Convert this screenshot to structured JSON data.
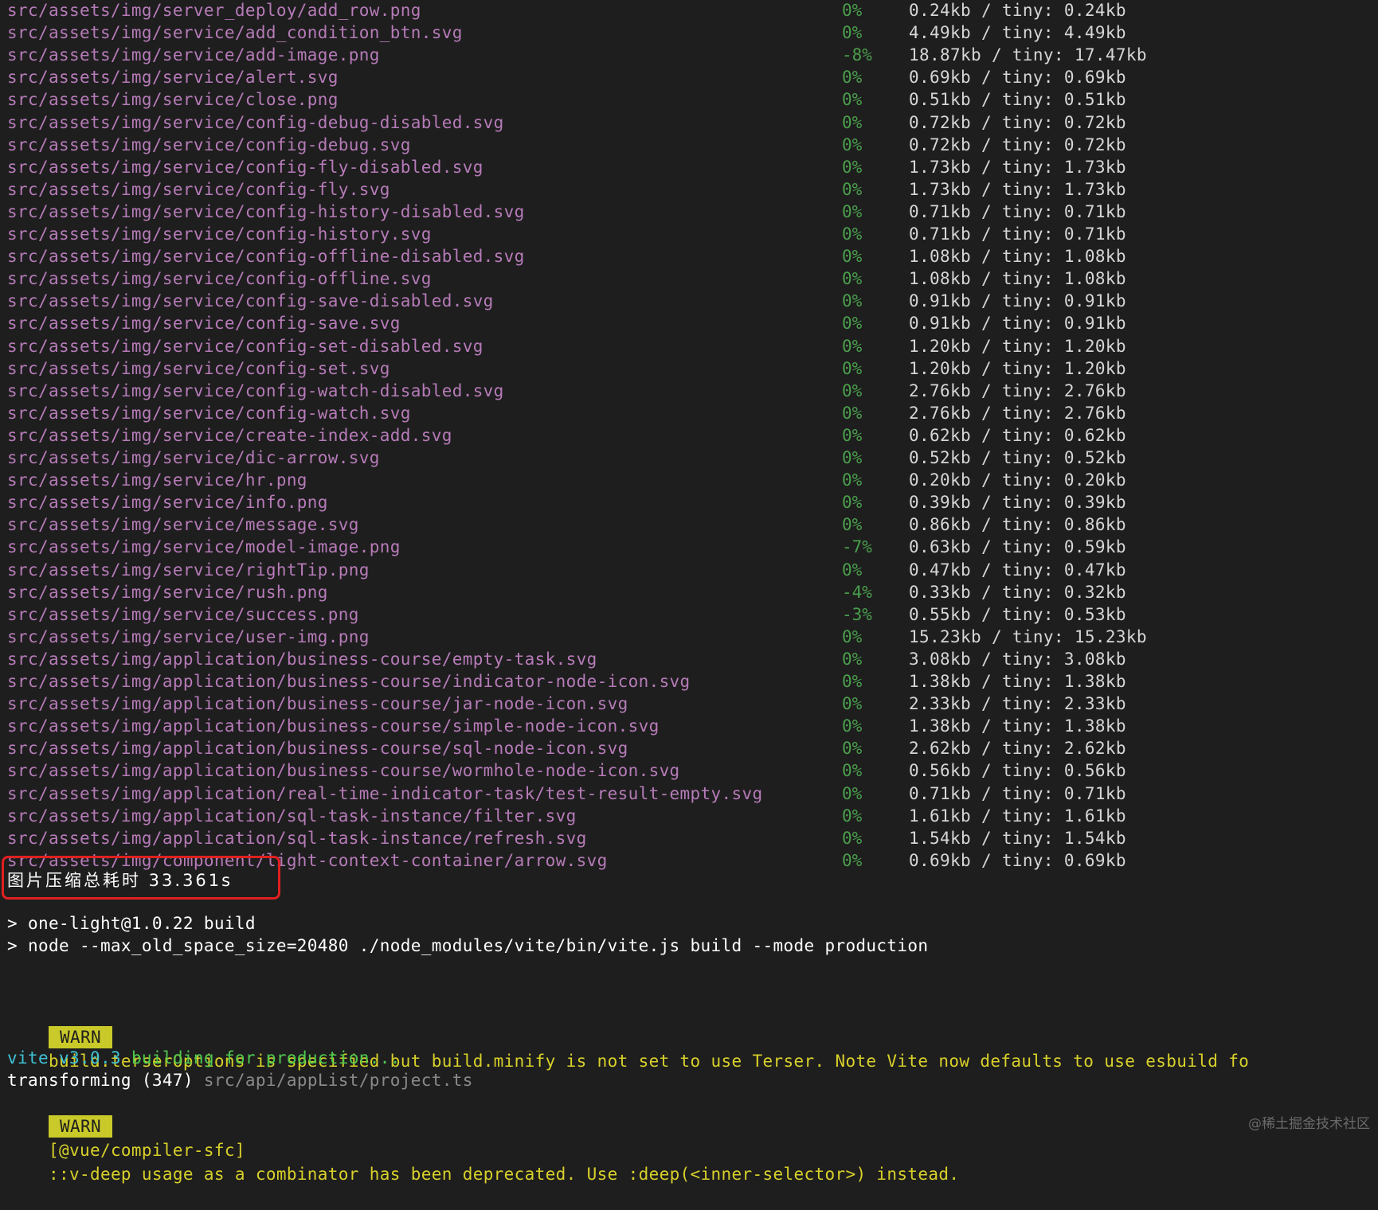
{
  "files": [
    {
      "path": "src/assets/img/server_deploy/add_row.png",
      "pct": "0%",
      "size": "0.24kb / tiny: 0.24kb"
    },
    {
      "path": "src/assets/img/service/add_condition_btn.svg",
      "pct": "0%",
      "size": "4.49kb / tiny: 4.49kb"
    },
    {
      "path": "src/assets/img/service/add-image.png",
      "pct": "-8%",
      "size": "18.87kb / tiny: 17.47kb"
    },
    {
      "path": "src/assets/img/service/alert.svg",
      "pct": "0%",
      "size": "0.69kb / tiny: 0.69kb"
    },
    {
      "path": "src/assets/img/service/close.png",
      "pct": "0%",
      "size": "0.51kb / tiny: 0.51kb"
    },
    {
      "path": "src/assets/img/service/config-debug-disabled.svg",
      "pct": "0%",
      "size": "0.72kb / tiny: 0.72kb"
    },
    {
      "path": "src/assets/img/service/config-debug.svg",
      "pct": "0%",
      "size": "0.72kb / tiny: 0.72kb"
    },
    {
      "path": "src/assets/img/service/config-fly-disabled.svg",
      "pct": "0%",
      "size": "1.73kb / tiny: 1.73kb"
    },
    {
      "path": "src/assets/img/service/config-fly.svg",
      "pct": "0%",
      "size": "1.73kb / tiny: 1.73kb"
    },
    {
      "path": "src/assets/img/service/config-history-disabled.svg",
      "pct": "0%",
      "size": "0.71kb / tiny: 0.71kb"
    },
    {
      "path": "src/assets/img/service/config-history.svg",
      "pct": "0%",
      "size": "0.71kb / tiny: 0.71kb"
    },
    {
      "path": "src/assets/img/service/config-offline-disabled.svg",
      "pct": "0%",
      "size": "1.08kb / tiny: 1.08kb"
    },
    {
      "path": "src/assets/img/service/config-offline.svg",
      "pct": "0%",
      "size": "1.08kb / tiny: 1.08kb"
    },
    {
      "path": "src/assets/img/service/config-save-disabled.svg",
      "pct": "0%",
      "size": "0.91kb / tiny: 0.91kb"
    },
    {
      "path": "src/assets/img/service/config-save.svg",
      "pct": "0%",
      "size": "0.91kb / tiny: 0.91kb"
    },
    {
      "path": "src/assets/img/service/config-set-disabled.svg",
      "pct": "0%",
      "size": "1.20kb / tiny: 1.20kb"
    },
    {
      "path": "src/assets/img/service/config-set.svg",
      "pct": "0%",
      "size": "1.20kb / tiny: 1.20kb"
    },
    {
      "path": "src/assets/img/service/config-watch-disabled.svg",
      "pct": "0%",
      "size": "2.76kb / tiny: 2.76kb"
    },
    {
      "path": "src/assets/img/service/config-watch.svg",
      "pct": "0%",
      "size": "2.76kb / tiny: 2.76kb"
    },
    {
      "path": "src/assets/img/service/create-index-add.svg",
      "pct": "0%",
      "size": "0.62kb / tiny: 0.62kb"
    },
    {
      "path": "src/assets/img/service/dic-arrow.svg",
      "pct": "0%",
      "size": "0.52kb / tiny: 0.52kb"
    },
    {
      "path": "src/assets/img/service/hr.png",
      "pct": "0%",
      "size": "0.20kb / tiny: 0.20kb"
    },
    {
      "path": "src/assets/img/service/info.png",
      "pct": "0%",
      "size": "0.39kb / tiny: 0.39kb"
    },
    {
      "path": "src/assets/img/service/message.svg",
      "pct": "0%",
      "size": "0.86kb / tiny: 0.86kb"
    },
    {
      "path": "src/assets/img/service/model-image.png",
      "pct": "-7%",
      "size": "0.63kb / tiny: 0.59kb"
    },
    {
      "path": "src/assets/img/service/rightTip.png",
      "pct": "0%",
      "size": "0.47kb / tiny: 0.47kb"
    },
    {
      "path": "src/assets/img/service/rush.png",
      "pct": "-4%",
      "size": "0.33kb / tiny: 0.32kb"
    },
    {
      "path": "src/assets/img/service/success.png",
      "pct": "-3%",
      "size": "0.55kb / tiny: 0.53kb"
    },
    {
      "path": "src/assets/img/service/user-img.png",
      "pct": "0%",
      "size": "15.23kb / tiny: 15.23kb"
    },
    {
      "path": "src/assets/img/application/business-course/empty-task.svg",
      "pct": "0%",
      "size": "3.08kb / tiny: 3.08kb"
    },
    {
      "path": "src/assets/img/application/business-course/indicator-node-icon.svg",
      "pct": "0%",
      "size": "1.38kb / tiny: 1.38kb"
    },
    {
      "path": "src/assets/img/application/business-course/jar-node-icon.svg",
      "pct": "0%",
      "size": "2.33kb / tiny: 2.33kb"
    },
    {
      "path": "src/assets/img/application/business-course/simple-node-icon.svg",
      "pct": "0%",
      "size": "1.38kb / tiny: 1.38kb"
    },
    {
      "path": "src/assets/img/application/business-course/sql-node-icon.svg",
      "pct": "0%",
      "size": "2.62kb / tiny: 2.62kb"
    },
    {
      "path": "src/assets/img/application/business-course/wormhole-node-icon.svg",
      "pct": "0%",
      "size": "0.56kb / tiny: 0.56kb"
    },
    {
      "path": "src/assets/img/application/real-time-indicator-task/test-result-empty.svg",
      "pct": "0%",
      "size": "0.71kb / tiny: 0.71kb"
    },
    {
      "path": "src/assets/img/application/sql-task-instance/filter.svg",
      "pct": "0%",
      "size": "1.61kb / tiny: 1.61kb"
    },
    {
      "path": "src/assets/img/application/sql-task-instance/refresh.svg",
      "pct": "0%",
      "size": "1.54kb / tiny: 1.54kb"
    },
    {
      "path": "src/assets/img/component/light-context-container/arrow.svg",
      "pct": "0%",
      "size": "0.69kb / tiny: 0.69kb"
    }
  ],
  "compress_summary": "图片压缩总耗时 33.361s",
  "commands": [
    "> one-light@1.0.22 build",
    "> node --max_old_space_size=20480 ./node_modules/vite/bin/vite.js build --mode production"
  ],
  "warn1": {
    "badge": "WARN",
    "text": "build.terserOptions is specified but build.minify is not set to use Terser. Note Vite now defaults to use esbuild fo"
  },
  "vite": {
    "name": "vite v3.0.3",
    "status": "building for production..."
  },
  "transforming": {
    "label": "transforming (347)",
    "file": "src/api/appList/project.ts"
  },
  "warn2": {
    "badge": "WARN",
    "tag": "[@vue/compiler-sfc]",
    "text": "::v-deep usage as a combinator has been deprecated. Use :deep(<inner-selector>) instead."
  },
  "watermark": "@稀土掘金技术社区",
  "colors": {
    "background": "#1e1e1e",
    "path": "#b67bb8",
    "pct": "#4a9e4c",
    "warn_badge": "#c9c92a",
    "warn_text": "#d8d02a",
    "highlight_border": "#e02020"
  }
}
